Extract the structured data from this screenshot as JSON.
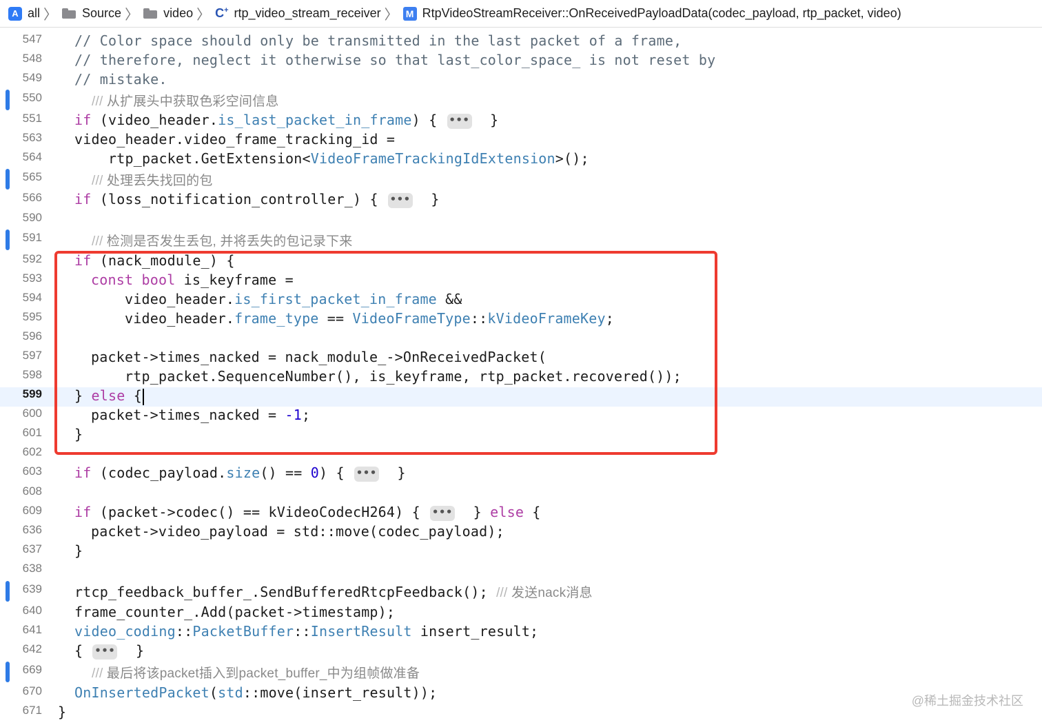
{
  "breadcrumb": {
    "items": [
      {
        "icon": "app-icon",
        "label": "all"
      },
      {
        "icon": "folder-icon",
        "label": "Source"
      },
      {
        "icon": "folder-icon",
        "label": "video"
      },
      {
        "icon": "cpp-file-icon",
        "label": "rtp_video_stream_receiver"
      },
      {
        "icon": "method-icon",
        "label": "RtpVideoStreamReceiver::OnReceivedPayloadData(codec_payload, rtp_packet, video)"
      }
    ]
  },
  "editor": {
    "current_line": "599",
    "lines": [
      {
        "n": "547",
        "text": "// Color space should only be transmitted in the last packet of a frame,"
      },
      {
        "n": "548",
        "text": "// therefore, neglect it otherwise so that last_color_space_ is not reset by"
      },
      {
        "n": "549",
        "text": "// mistake."
      },
      {
        "n": "550",
        "text": "/// 从扩展头中获取色彩空间信息",
        "bookmark": true
      },
      {
        "n": "551",
        "text": "if (video_header.is_last_packet_in_frame) { ••• }"
      },
      {
        "n": "563",
        "text": "video_header.video_frame_tracking_id ="
      },
      {
        "n": "564",
        "text": "rtp_packet.GetExtension<VideoFrameTrackingIdExtension>();"
      },
      {
        "n": "565",
        "text": "/// 处理丢失找回的包",
        "bookmark": true
      },
      {
        "n": "566",
        "text": "if (loss_notification_controller_) { ••• }"
      },
      {
        "n": "590",
        "text": ""
      },
      {
        "n": "591",
        "text": "/// 检测是否发生丢包, 并将丢失的包记录下来",
        "bookmark": true
      },
      {
        "n": "592",
        "text": "if (nack_module_) {"
      },
      {
        "n": "593",
        "text": "const bool is_keyframe ="
      },
      {
        "n": "594",
        "text": "video_header.is_first_packet_in_frame &&"
      },
      {
        "n": "595",
        "text": "video_header.frame_type == VideoFrameType::kVideoFrameKey;"
      },
      {
        "n": "596",
        "text": ""
      },
      {
        "n": "597",
        "text": "packet->times_nacked = nack_module_->OnReceivedPacket("
      },
      {
        "n": "598",
        "text": "rtp_packet.SequenceNumber(), is_keyframe, rtp_packet.recovered());"
      },
      {
        "n": "599",
        "text": "} else {"
      },
      {
        "n": "600",
        "text": "packet->times_nacked = -1;"
      },
      {
        "n": "601",
        "text": "}"
      },
      {
        "n": "602",
        "text": ""
      },
      {
        "n": "603",
        "text": "if (codec_payload.size() == 0) { ••• }"
      },
      {
        "n": "608",
        "text": ""
      },
      {
        "n": "609",
        "text": "if (packet->codec() == kVideoCodecH264) { ••• } else {"
      },
      {
        "n": "636",
        "text": "packet->video_payload = std::move(codec_payload);"
      },
      {
        "n": "637",
        "text": "}"
      },
      {
        "n": "638",
        "text": ""
      },
      {
        "n": "639",
        "text": "rtcp_feedback_buffer_.SendBufferedRtcpFeedback(); /// 发送nack消息",
        "bookmark": true
      },
      {
        "n": "640",
        "text": "frame_counter_.Add(packet->timestamp);"
      },
      {
        "n": "641",
        "text": "video_coding::PacketBuffer::InsertResult insert_result;"
      },
      {
        "n": "642",
        "text": "{ ••• }"
      },
      {
        "n": "669",
        "text": "/// 最后将该packet插入到packet_buffer_中为组帧做准备",
        "bookmark": true
      },
      {
        "n": "670",
        "text": "OnInsertedPacket(std::move(insert_result));"
      },
      {
        "n": "671",
        "text": "}"
      }
    ]
  },
  "watermark": "@稀土掘金技术社区",
  "colors": {
    "keyword": "#ad3da4",
    "member": "#3e80b2",
    "comment": "#5d6c79",
    "number": "#1c00cf",
    "highlight_box": "#ee3b30",
    "bookmark": "#2e7be6",
    "current_line_bg": "#ecf4ff"
  }
}
